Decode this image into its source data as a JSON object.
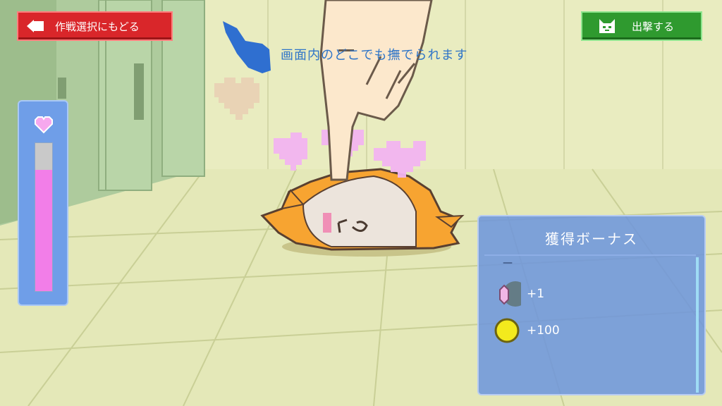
{
  "header": {
    "back_label": "作戦選択にもどる",
    "sortie_label": "出撃する"
  },
  "hint": "画面内のどこでも撫でられます",
  "affection_gauge": {
    "level_fraction": 0.82
  },
  "bonus_panel": {
    "title": "獲得ボーナス",
    "separator": "—",
    "rows": [
      {
        "icon": "crystal-icon",
        "value": "+1"
      },
      {
        "icon": "gold-coin-icon",
        "value": "+100"
      }
    ]
  },
  "colors": {
    "back_button": "#d9262a",
    "sortie_button": "#2f9a2f",
    "gauge_fill": "#f27ee8",
    "panel": "#6e96dc",
    "hint_text": "#2f75c8"
  }
}
